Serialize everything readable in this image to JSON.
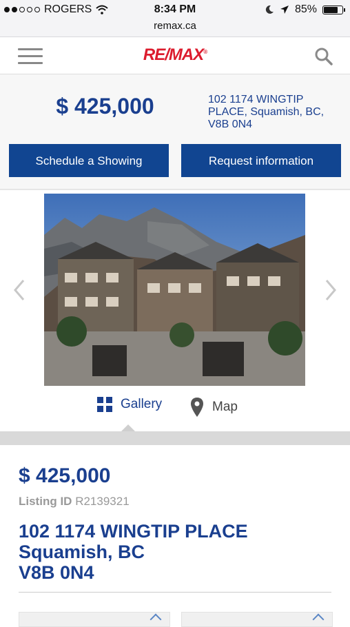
{
  "status": {
    "carrier": "ROGERS",
    "time": "8:34 PM",
    "battery_text": "85%",
    "battery_level": 0.85,
    "signal_bars_filled": 2,
    "signal_bars_total": 5
  },
  "browser": {
    "url": "remax.ca"
  },
  "header": {
    "logo_text": "RE/MAX",
    "logo_mark": "®"
  },
  "listing": {
    "price": "$ 425,000",
    "address_short": "102 1174 WINGTIP PLACE, Squamish, BC, V8B 0N4",
    "listing_id_label": "Listing ID",
    "listing_id": "R2139321",
    "address_line1": "102 1174 WINGTIP PLACE",
    "address_line2": "Squamish, BC",
    "address_line3": "V8B 0N4"
  },
  "actions": {
    "schedule_label": "Schedule a Showing",
    "request_label": "Request information"
  },
  "tabs": {
    "gallery_label": "Gallery",
    "map_label": "Map",
    "active": "gallery"
  },
  "colors": {
    "brand_blue": "#114591",
    "text_blue": "#1a3f8f",
    "remax_red": "#dc1c2e"
  },
  "icons": [
    "wifi-icon",
    "moon-icon",
    "location-arrow-icon",
    "battery-icon",
    "hamburger-menu-icon",
    "search-icon",
    "chevron-left-icon",
    "chevron-right-icon",
    "grid-icon",
    "map-pin-icon"
  ]
}
